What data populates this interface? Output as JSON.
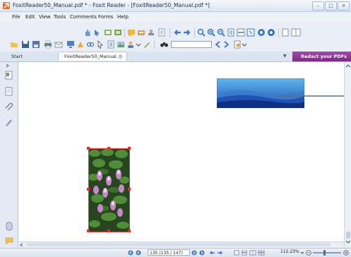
{
  "window": {
    "title": "FoxitReader50_Manual.pdf * - Foxit Reader - [FoxitReader50_Manual.pdf *]",
    "min_glyph": "–",
    "max_glyph": "□",
    "close_glyph": "×"
  },
  "menu": [
    "File",
    "Edit",
    "View",
    "Tools",
    "Comments",
    "Forms",
    "Help"
  ],
  "toolbar": {
    "search_placeholder": ""
  },
  "tabs": {
    "start_label": "Start",
    "doc_label": "FoxitReader50_Manual....",
    "close_glyph": "×",
    "dropdown_glyph": "▼",
    "promo_label": "Redact your PDFs"
  },
  "status": {
    "page_readout": "135 (135 / 147)",
    "zoom_readout": "112.23%"
  },
  "colors": {
    "accent": "#7a2a86",
    "chrome": "#e9eef6",
    "selection_handle": "#ff2020"
  }
}
